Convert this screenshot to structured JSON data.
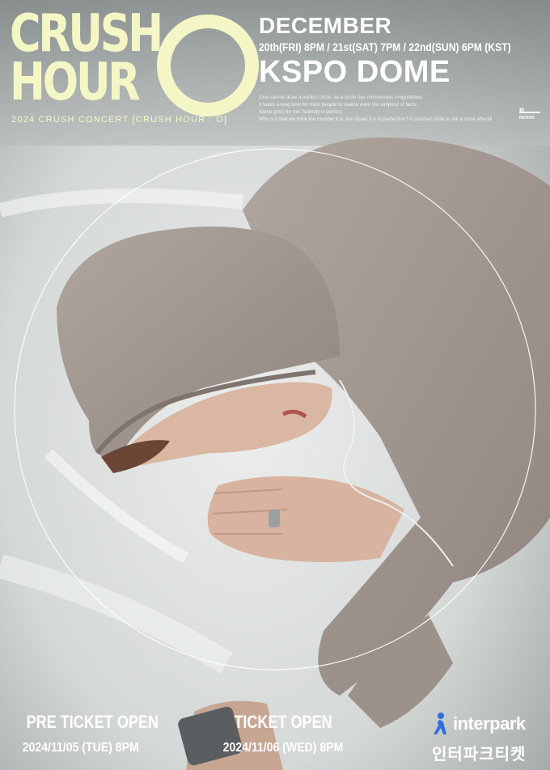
{
  "title": {
    "line1": "CRUSH",
    "line2": "HOUR",
    "letter_o": "O"
  },
  "subtitle": "2024 CRUSH CONCERT [CRUSH HOUR : O]",
  "event": {
    "month": "DECEMBER",
    "dates": "20th(FRI) 8PM / 21st(SAT) 7PM / 22nd(SUN) 6PM (KST)",
    "venue": "KSPO DOME"
  },
  "description": [
    "One cannot draw a perfect circle, as a circle has microscopic irregularities.",
    "It takes a long time for most people to realize even the simplest of facts.",
    "Same goes for me. Nobody is perfect.",
    "Why is it that we think the rounder it is, the closer it is to perfection? A crushed circle is still a circle afterall."
  ],
  "label_logo": "NATION",
  "tickets": [
    {
      "title": "PRE TICKET OPEN",
      "date": "2024/11/05 (TUE) 8PM"
    },
    {
      "title": "TICKET OPEN",
      "date": "2024/11/06 (WED) 8PM"
    }
  ],
  "vendor": {
    "name": "interpark",
    "name_kr": "인터파크티켓",
    "icon": "interpark-figure-icon"
  },
  "colors": {
    "title_yellow": "#f4f7c5",
    "text_white": "#ffffff",
    "brand_blue": "#2f6fe0"
  }
}
